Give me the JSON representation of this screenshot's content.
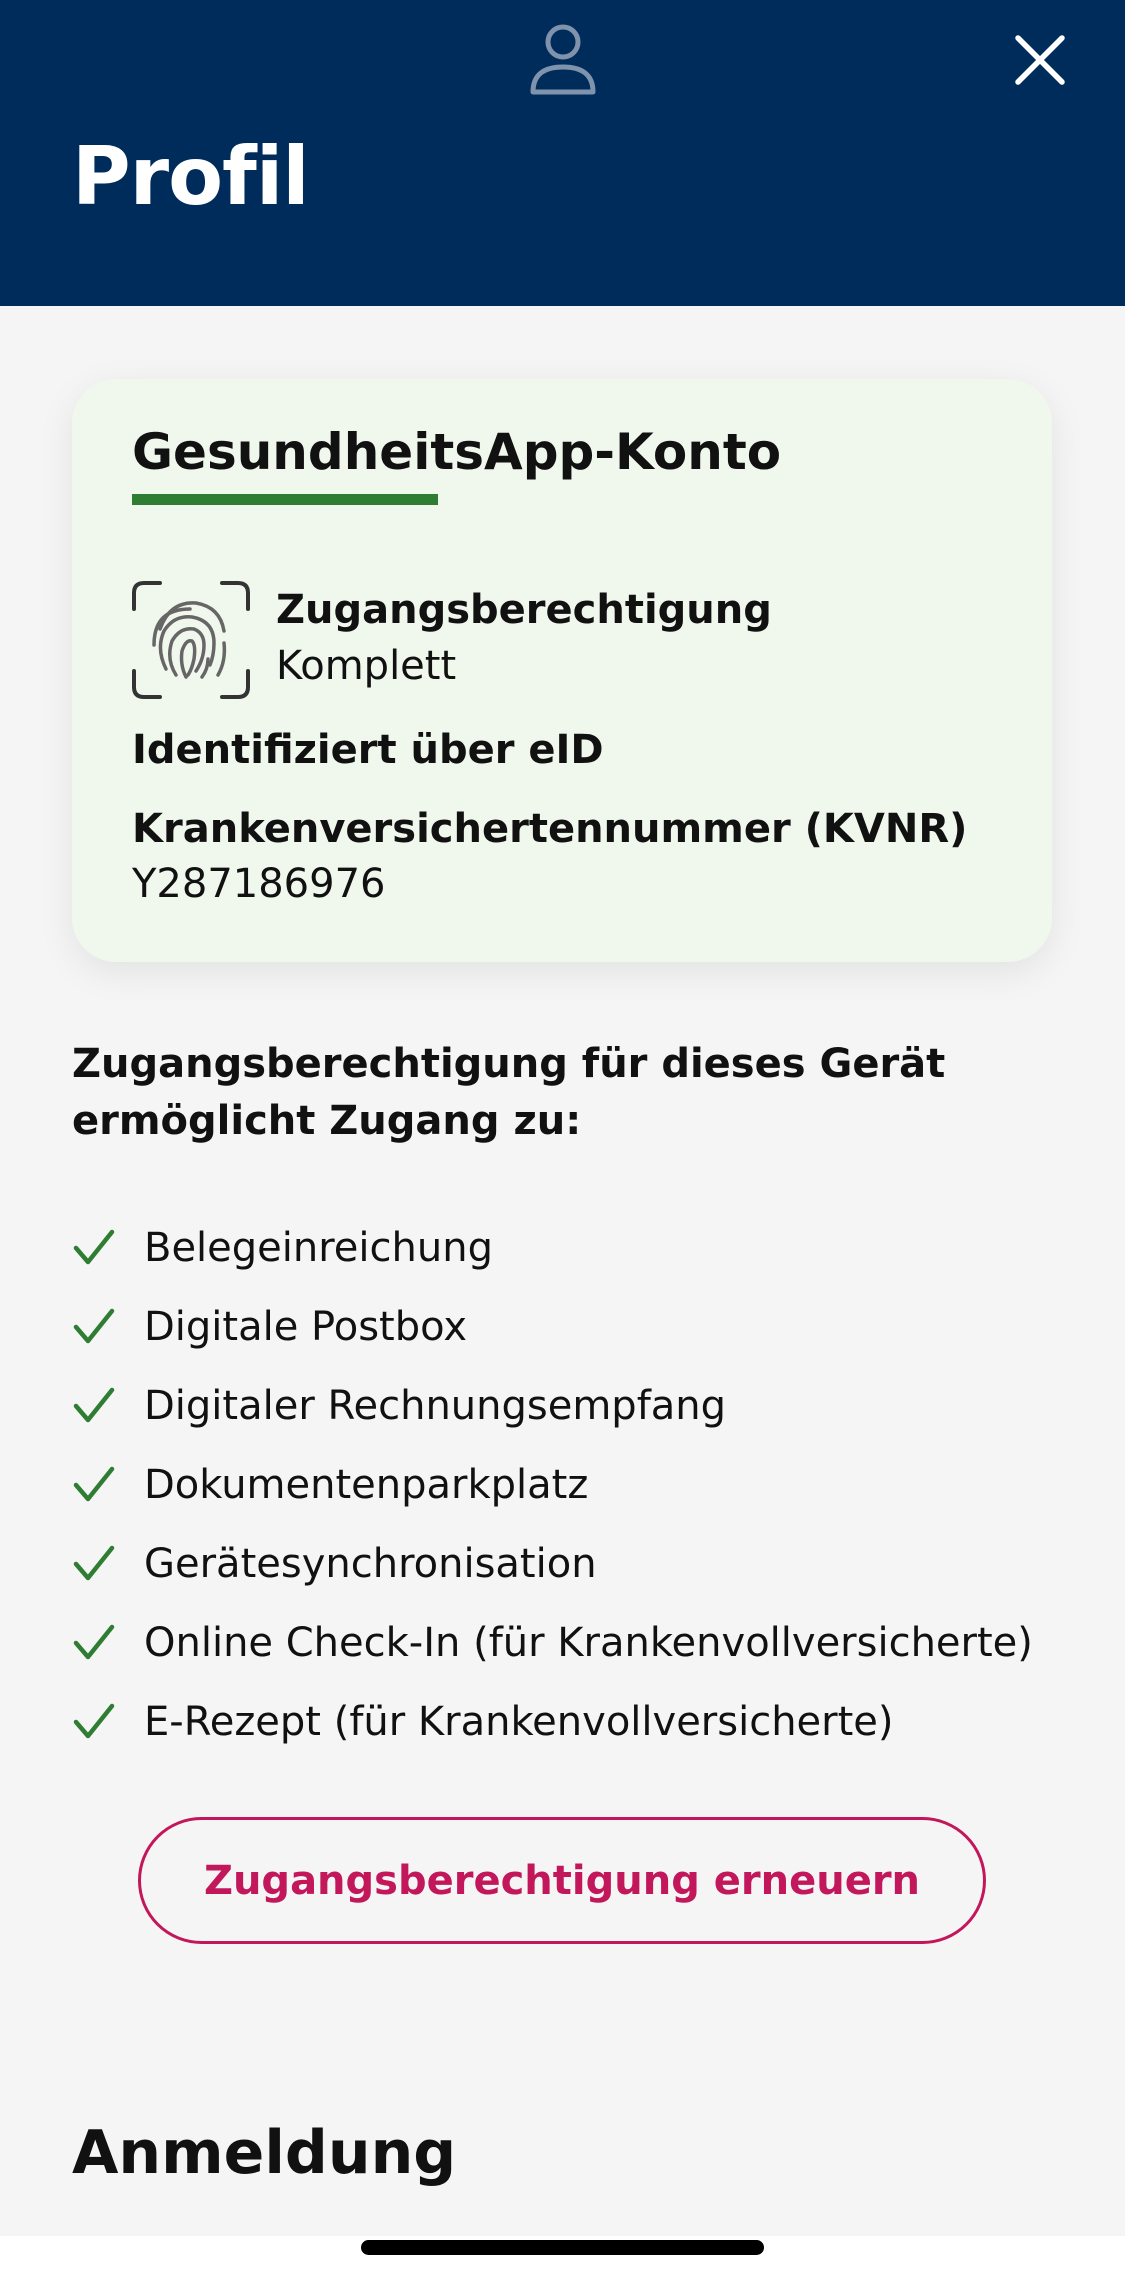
{
  "header": {
    "title": "Profil",
    "avatar_icon": "person-icon",
    "close_icon": "close-icon",
    "background": "#002c5c"
  },
  "account_card": {
    "title": "GesundheitsApp-Konto",
    "access_label": "Zugangsberechtigung",
    "access_value": "Komplett",
    "fingerprint_icon": "fingerprint-icon",
    "identified": "Identifiziert über eID",
    "kvnr_label": "Krankenversichertennummer (KVNR)",
    "kvnr_value": "Y287186976",
    "accent": "#2e7d32"
  },
  "access_section": {
    "heading": "Zugangsberechtigung für dieses Gerät ermöglicht Zugang zu:",
    "features": [
      "Belegeinreichung",
      "Digitale Postbox",
      "Digitaler Rechnungsempfang",
      "Dokumentenparkplatz",
      "Gerätesynchronisation",
      "Online Check-In (für Krankenvollversicherte)",
      "E-Rezept (für Krankenvollversicherte)"
    ],
    "check_icon": "check-icon",
    "check_color": "#2e7d32"
  },
  "renew_button": {
    "label": "Zugangsberechtigung erneuern",
    "color": "#c2185b"
  },
  "login_section": {
    "heading": "Anmeldung"
  }
}
